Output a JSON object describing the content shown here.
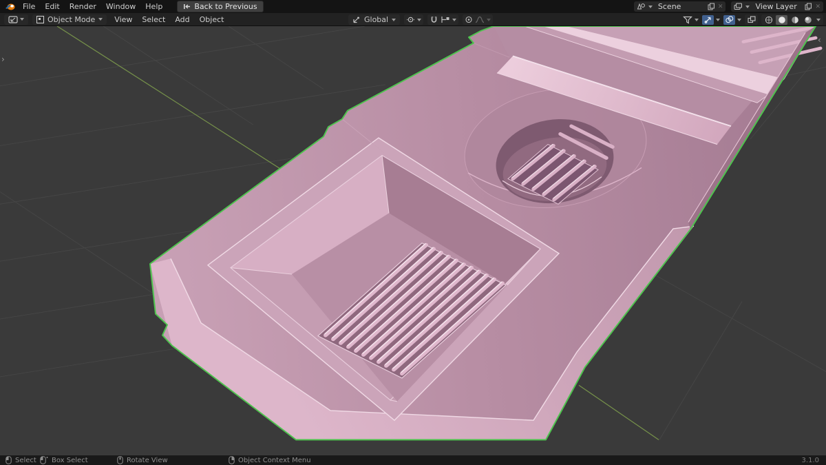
{
  "app": {
    "name": "Blender",
    "version": "3.1.0"
  },
  "topbar": {
    "menus": [
      "File",
      "Edit",
      "Render",
      "Window",
      "Help"
    ],
    "back_button": "Back to Previous",
    "scene_selector": {
      "value": "Scene"
    },
    "view_layer_selector": {
      "value": "View Layer"
    }
  },
  "viewport_header": {
    "mode": "Object Mode",
    "menus": [
      "View",
      "Select",
      "Add",
      "Object"
    ],
    "transform_orientation": "Global",
    "shading_active": "solid",
    "gizmos_enabled": true,
    "overlays_enabled": true
  },
  "viewport": {
    "toolbar_expand_arrow": "›",
    "sidebar_expand_arrow": "‹",
    "background_color": "#3a3a3a",
    "grid_color": "#464646",
    "axis_y_color": "#75904a",
    "selected_outline_color": "#4ec44e",
    "object_color": "#c49db2",
    "selected_object": "pink mold tray with slatted pockets"
  },
  "statusbar": {
    "hints": [
      {
        "icon": "mouse-left",
        "label": "Select"
      },
      {
        "icon": "mouse-left-drag",
        "label": "Box Select"
      },
      {
        "icon": "mouse-middle",
        "label": "Rotate View"
      },
      {
        "icon": "mouse-right",
        "label": "Object Context Menu"
      }
    ],
    "version": "3.1.0"
  },
  "icons": {
    "blender_logo_color": "#ea7600",
    "toggle_on_color": "#41618f",
    "list": [
      "blender-logo",
      "back-icon",
      "scene-icon",
      "new-scene-icon",
      "unlink-icon",
      "view-layer-icon",
      "editor-type-icon",
      "object-mode-icon",
      "orientation-icon",
      "pivot-icon",
      "magnet-icon",
      "snap-target-icon",
      "proportional-icon",
      "falloff-icon",
      "visibility-filter-icon",
      "gizmo-icon",
      "overlays-icon",
      "xray-icon",
      "wireframe-shading-icon",
      "solid-shading-icon",
      "material-shading-icon",
      "rendered-shading-icon"
    ]
  }
}
